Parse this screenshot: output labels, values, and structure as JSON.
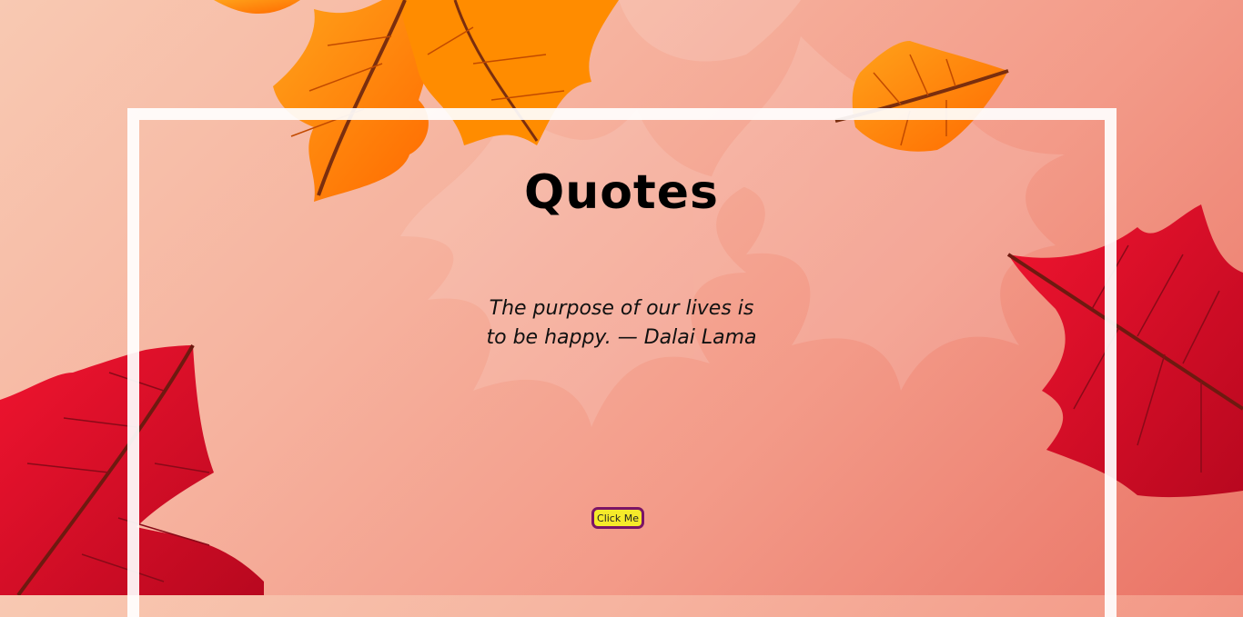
{
  "page": {
    "title": "Quotes",
    "quote": "The purpose of our lives is to be happy. — Dalai Lama",
    "button_label": "Click Me"
  },
  "colors": {
    "frame": "#ffffff",
    "button_bg": "#f5ea2a",
    "button_border": "#7a1466",
    "orange_leaf": "#ff8a00",
    "red_leaf": "#e8112d"
  }
}
